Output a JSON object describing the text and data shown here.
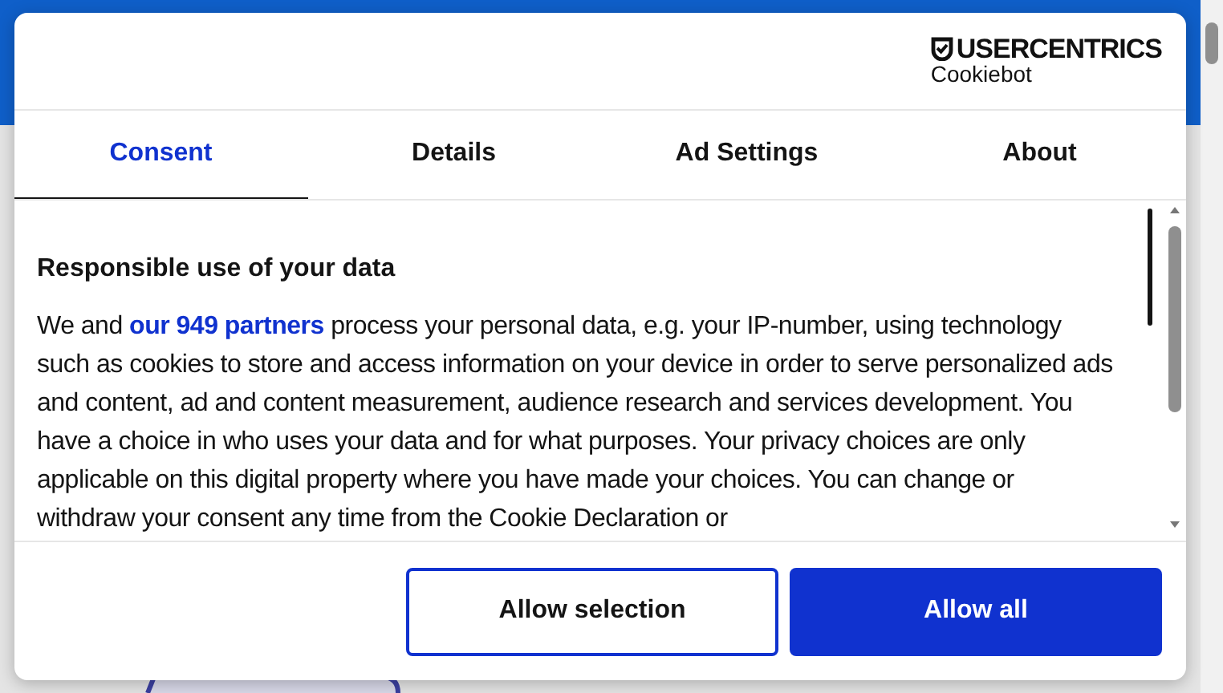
{
  "logo": {
    "brand": "USERCENTRICS",
    "product": "Cookiebot"
  },
  "tabs": [
    {
      "label": "Consent",
      "selected": true
    },
    {
      "label": "Details",
      "selected": false
    },
    {
      "label": "Ad Settings",
      "selected": false
    },
    {
      "label": "About",
      "selected": false
    }
  ],
  "content": {
    "heading": "Responsible use of your data",
    "text_before": "We and ",
    "link": "our 949 partners",
    "text_after": " process your personal data, e.g. your IP-number, using technology such as cookies to store and access information on your device in order to serve personalized ads and content, ad and content measurement, audience research and services development. You have a choice in who uses your data and for what purposes. Your privacy choices are only applicable on this digital property where you have made your choices. You can change or withdraw your consent any time from the Cookie Declaration or"
  },
  "buttons": [
    {
      "label": "Allow selection",
      "kind": "outline"
    },
    {
      "label": "Allow all",
      "kind": "primary"
    }
  ]
}
